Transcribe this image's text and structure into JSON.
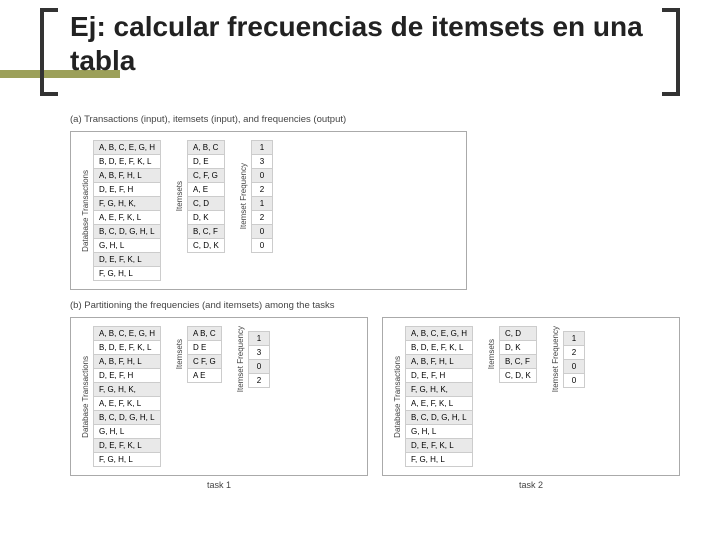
{
  "title": "Ej: calcular frecuencias de itemsets en una tabla",
  "caption_a": "(a) Transactions (input), itemsets (input), and frequencies (output)",
  "caption_b": "(b) Partitioning the frequencies (and itemsets) among the tasks",
  "labels": {
    "transactions": "Database Transactions",
    "itemsets": "Itemsets",
    "freq": "Itemset Frequency"
  },
  "transactions": [
    "A, B, C, E, G, H",
    "B, D, E, F, K, L",
    "A, B, F, H, L",
    "D, E, F, H",
    "F, G, H, K,",
    "A, E, F, K, L",
    "B, C, D, G, H, L",
    "G, H, L",
    "D, E, F, K, L",
    "F, G, H, L"
  ],
  "itemsets_a": [
    "A, B, C",
    "D, E",
    "C, F, G",
    "A, E",
    "C, D",
    "D, K",
    "B, C, F",
    "C, D, K"
  ],
  "freq_a": [
    "1",
    "3",
    "0",
    "2",
    "1",
    "2",
    "0",
    "0"
  ],
  "task1": {
    "itemsets": [
      "A  B, C",
      "D  E",
      "C  F, G",
      "A  E"
    ],
    "freq": [
      "1",
      "3",
      "0",
      "2"
    ],
    "label": "task 1"
  },
  "task2": {
    "itemsets": [
      "C, D",
      "D, K",
      "B, C, F",
      "C, D, K"
    ],
    "freq": [
      "1",
      "2",
      "0",
      "0"
    ],
    "label": "task 2"
  }
}
